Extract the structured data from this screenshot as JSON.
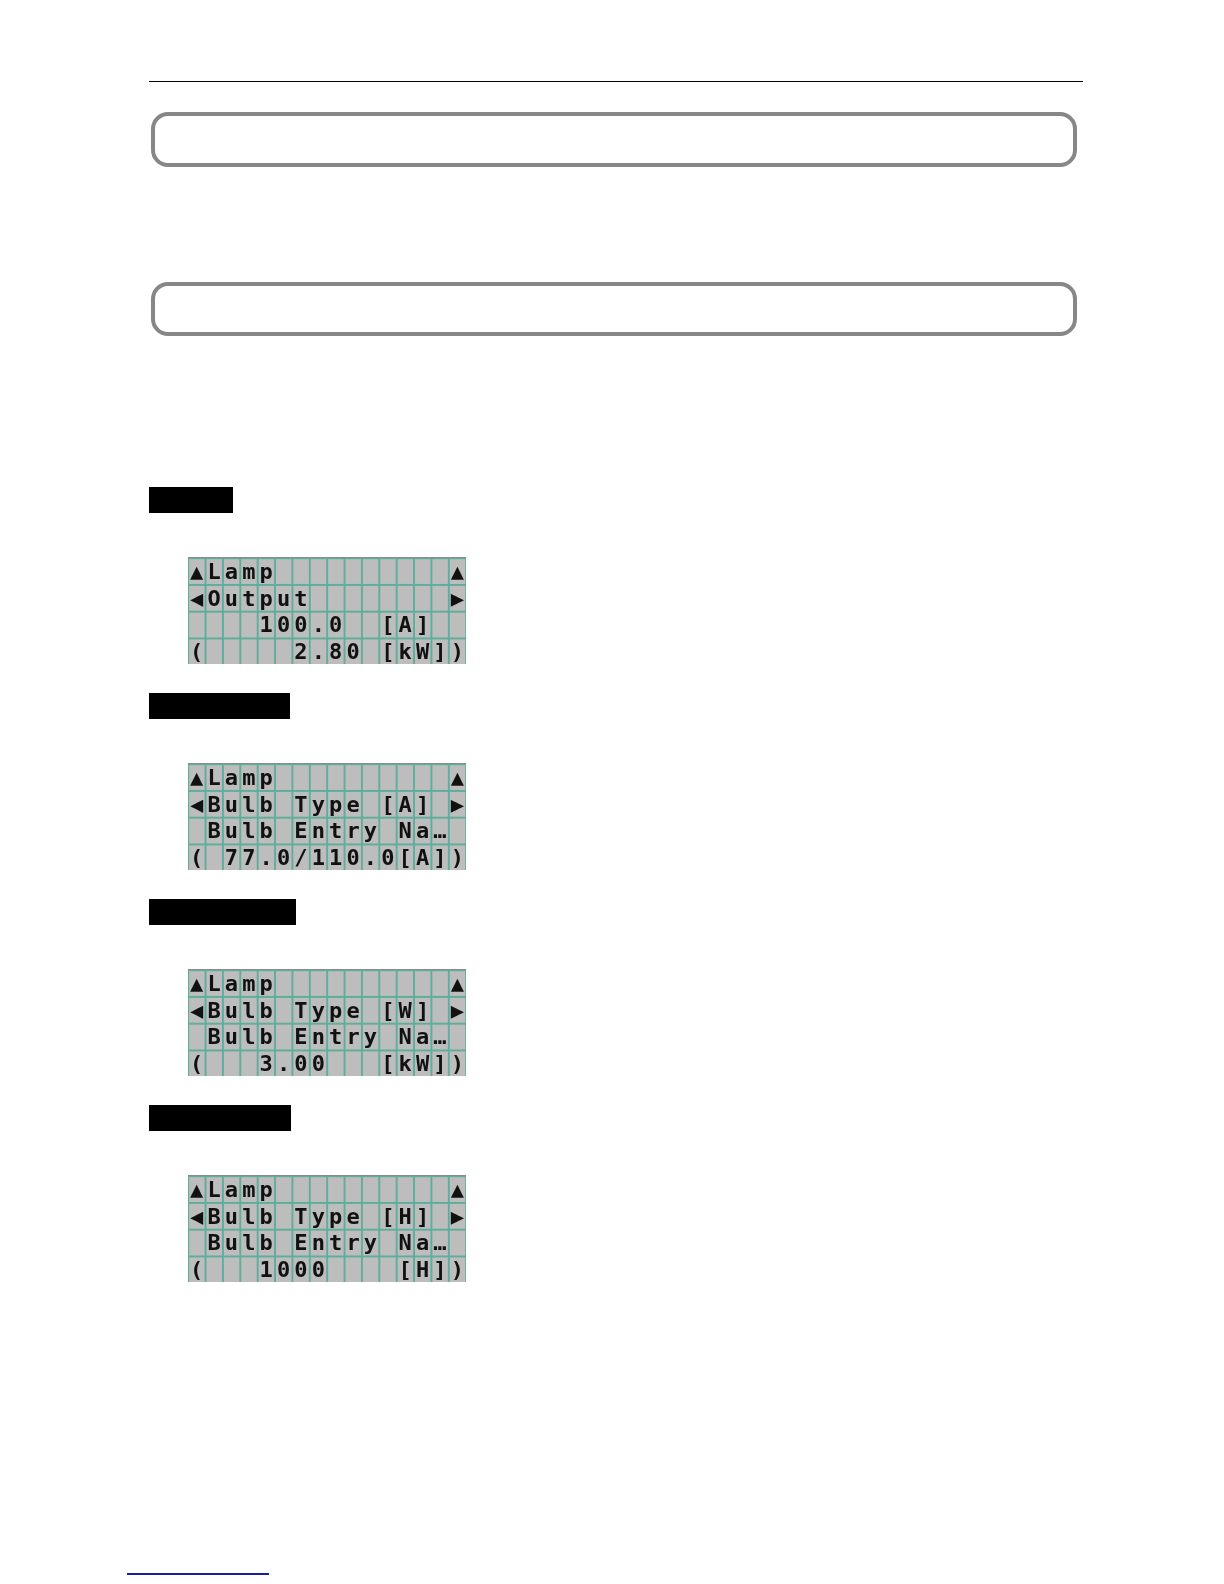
{
  "sections": [
    {
      "display": {
        "rows": [
          "▲Lamp          ▲",
          "◀Output        ▶",
          "    100.0  [A]",
          "(     2.80 [kW])"
        ]
      }
    },
    {
      "display": {
        "rows": [
          "▲Lamp          ▲",
          "◀Bulb Type [A] ▶",
          " Bulb Entry Na…",
          "( 77.0/110.0[A])"
        ]
      }
    },
    {
      "display": {
        "rows": [
          "▲Lamp          ▲",
          "◀Bulb Type [W] ▶",
          " Bulb Entry Na…",
          "(   3.00   [kW])"
        ]
      }
    },
    {
      "display": {
        "rows": [
          "▲Lamp          ▲",
          "◀Bulb Type [H] ▶",
          " Bulb Entry Na…",
          "(   1000    [H])"
        ]
      }
    }
  ]
}
